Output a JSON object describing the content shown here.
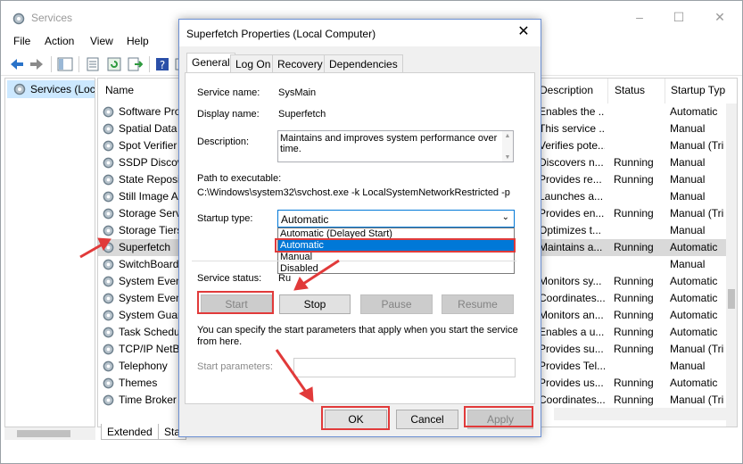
{
  "window": {
    "title": "Services"
  },
  "menu": [
    "File",
    "Action",
    "View",
    "Help"
  ],
  "tree": {
    "node_label": "Services (Loca"
  },
  "columns": {
    "name": "Name",
    "description": "Description",
    "status": "Status",
    "startup": "Startup Typ"
  },
  "services": [
    {
      "name": "Software Pro",
      "description": "Enables the ...",
      "status": "",
      "startup": "Automatic"
    },
    {
      "name": "Spatial Data S",
      "description": "This service ...",
      "status": "",
      "startup": "Manual"
    },
    {
      "name": "Spot Verifier",
      "description": "Verifies pote...",
      "status": "",
      "startup": "Manual (Tri"
    },
    {
      "name": "SSDP Discove",
      "description": "Discovers n...",
      "status": "Running",
      "startup": "Manual"
    },
    {
      "name": "State Reposit",
      "description": "Provides re...",
      "status": "Running",
      "startup": "Manual"
    },
    {
      "name": "Still Image A",
      "description": "Launches a...",
      "status": "",
      "startup": "Manual"
    },
    {
      "name": "Storage Servi",
      "description": "Provides en...",
      "status": "Running",
      "startup": "Manual (Tri"
    },
    {
      "name": "Storage Tiers",
      "description": "Optimizes t...",
      "status": "",
      "startup": "Manual"
    },
    {
      "name": "Superfetch",
      "description": "Maintains a...",
      "status": "Running",
      "startup": "Automatic"
    },
    {
      "name": "SwitchBoard",
      "description": "",
      "status": "",
      "startup": "Manual"
    },
    {
      "name": "System Event",
      "description": "Monitors sy...",
      "status": "Running",
      "startup": "Automatic"
    },
    {
      "name": "System Event",
      "description": "Coordinates...",
      "status": "Running",
      "startup": "Automatic"
    },
    {
      "name": "System Guard",
      "description": "Monitors an...",
      "status": "Running",
      "startup": "Automatic"
    },
    {
      "name": "Task Schedul",
      "description": "Enables a u...",
      "status": "Running",
      "startup": "Automatic"
    },
    {
      "name": "TCP/IP NetBI",
      "description": "Provides su...",
      "status": "Running",
      "startup": "Manual (Tri"
    },
    {
      "name": "Telephony",
      "description": "Provides Tel...",
      "status": "",
      "startup": "Manual"
    },
    {
      "name": "Themes",
      "description": "Provides us...",
      "status": "Running",
      "startup": "Automatic"
    },
    {
      "name": "Time Broker",
      "description": "Coordinates...",
      "status": "Running",
      "startup": "Manual (Tri"
    }
  ],
  "bottom_tabs": {
    "extended": "Extended",
    "standard": "Sta"
  },
  "dialog": {
    "title": "Superfetch Properties (Local Computer)",
    "tabs": [
      "General",
      "Log On",
      "Recovery",
      "Dependencies"
    ],
    "service_name_label": "Service name:",
    "service_name": "SysMain",
    "display_name_label": "Display name:",
    "display_name": "Superfetch",
    "description_label": "Description:",
    "description": "Maintains and improves system performance over time.",
    "path_label": "Path to executable:",
    "path": "C:\\Windows\\system32\\svchost.exe -k LocalSystemNetworkRestricted -p",
    "startup_type_label": "Startup type:",
    "startup_type_value": "Automatic",
    "startup_options": [
      "Automatic (Delayed Start)",
      "Automatic",
      "Manual",
      "Disabled"
    ],
    "service_status_label": "Service status:",
    "service_status": "Ru",
    "buttons": {
      "start": "Start",
      "stop": "Stop",
      "pause": "Pause",
      "resume": "Resume"
    },
    "hint": "You can specify the start parameters that apply when you start the service from here.",
    "params_label": "Start parameters:",
    "ok": "OK",
    "cancel": "Cancel",
    "apply": "Apply"
  },
  "colors": {
    "annotation_red": "#e13a3a",
    "selection_blue": "#0078d7"
  }
}
